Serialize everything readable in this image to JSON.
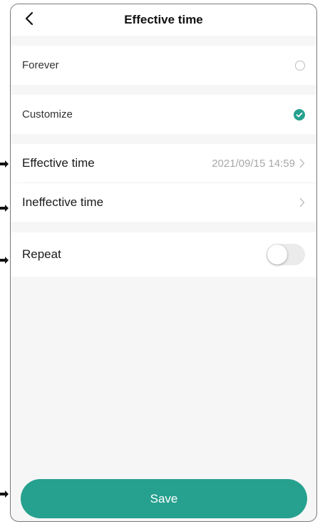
{
  "header": {
    "title": "Effective time",
    "back_icon": "chevron-left-icon"
  },
  "options": {
    "forever": {
      "label": "Forever",
      "selected": false
    },
    "customize": {
      "label": "Customize",
      "selected": true
    }
  },
  "times": {
    "effective": {
      "label": "Effective time",
      "value": "2021/09/15 14:59"
    },
    "ineffective": {
      "label": "Ineffective time",
      "value": ""
    }
  },
  "repeat": {
    "label": "Repeat",
    "enabled": false
  },
  "footer": {
    "save_label": "Save"
  },
  "colors": {
    "accent": "#26a08f",
    "toggle_off": "#ebebeb",
    "muted": "#a8a8a8"
  }
}
